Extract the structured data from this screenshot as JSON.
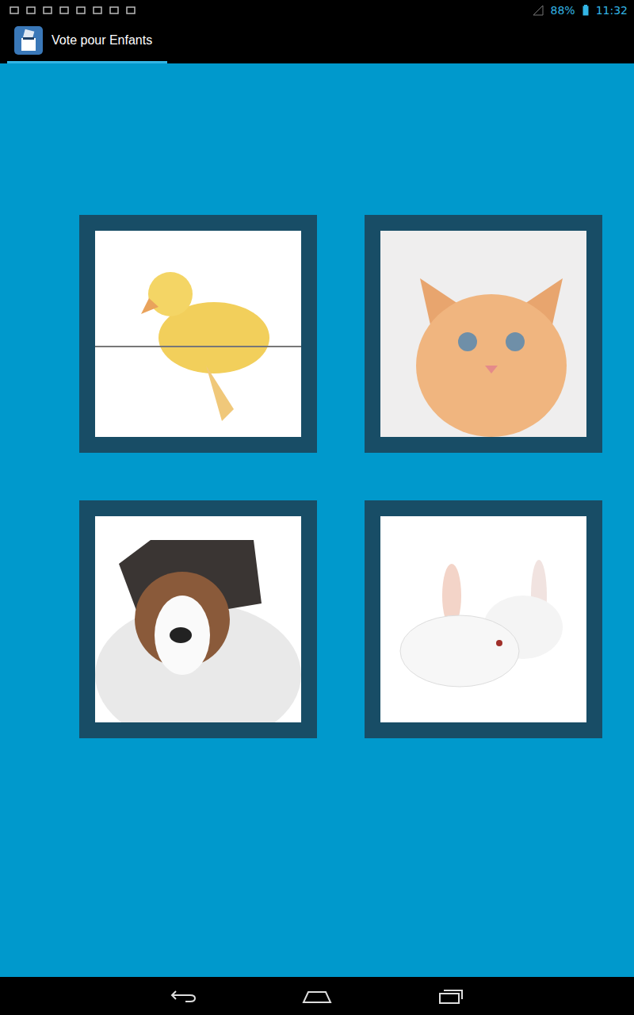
{
  "status_bar": {
    "battery": "88%",
    "time": "11:32"
  },
  "action_bar": {
    "title": "Vote pour Enfants"
  },
  "choices": [
    {},
    {},
    {},
    {}
  ]
}
